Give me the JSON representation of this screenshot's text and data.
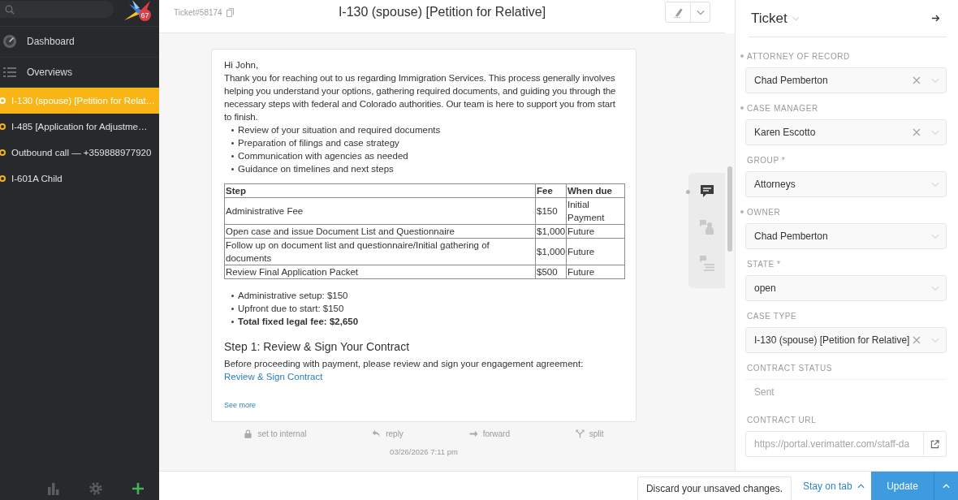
{
  "sidebar": {
    "notification_count": "67",
    "nav": [
      {
        "label": "Dashboard"
      },
      {
        "label": "Overviews"
      }
    ],
    "tabs": [
      {
        "label": "I-130 (spouse) [Petition for Relat…",
        "selected": true
      },
      {
        "label": "I-485 [Application for Adjustme…",
        "selected": false
      },
      {
        "label": "Outbound call — +359888977920",
        "selected": false
      },
      {
        "label": "I-601A Child",
        "selected": false
      }
    ]
  },
  "header": {
    "ticket_number": "Ticket#58174",
    "title": "I-130 (spouse) [Petition for Relative]"
  },
  "article": {
    "greeting": "Hi John,",
    "intro": "Thank you for reaching out to us regarding Immigration Services. This process generally involves helping you understand your options, gathering required documents, and guiding you through the necessary steps with federal and Colorado authorities. Our team is here to support you from start to finish.",
    "services": [
      "Review of your situation and required documents",
      "Preparation of filings and case strategy",
      "Communication with agencies as needed",
      "Guidance on timelines and next steps"
    ],
    "fee_table": {
      "columns": [
        "Step",
        "Fee",
        "When due"
      ],
      "rows": [
        [
          "Administrative Fee",
          "$150",
          "Initial Payment"
        ],
        [
          "Open case and issue Document List and Questionnaire",
          "$1,000",
          "Future"
        ],
        [
          "Follow up on document list and questionnaire/Initial gathering of documents",
          "$1,000",
          "Future"
        ],
        [
          "Review Final Application Packet",
          "$500",
          "Future"
        ]
      ]
    },
    "summary": [
      {
        "text": "Administrative setup: $150",
        "bold": false
      },
      {
        "text": "Upfront due to start: $150",
        "bold": false
      },
      {
        "text": "Total fixed legal fee: $2,650",
        "bold": true
      }
    ],
    "heading": "Step 1: Review & Sign Your Contract",
    "instruction": "Before proceeding with payment, please review and sign your engagement agreement:",
    "link": "Review & Sign Contract",
    "see_more": "See more",
    "actions": [
      {
        "label": "set to internal"
      },
      {
        "label": "reply"
      },
      {
        "label": "forward"
      },
      {
        "label": "split"
      }
    ],
    "timestamp": "03/26/2026 7:11 pm"
  },
  "sidebar_tabs": [
    {
      "selected": true
    },
    {
      "selected": false
    },
    {
      "selected": false
    }
  ],
  "ticket_panel": {
    "title": "Ticket",
    "fields": [
      {
        "label": "ATTORNEY OF RECORD",
        "value": "Chad Pemberton",
        "kind": "select",
        "changed": true,
        "clearable": true
      },
      {
        "label": "CASE MANAGER",
        "value": "Karen Escotto",
        "kind": "select",
        "changed": true,
        "clearable": true
      },
      {
        "label": "GROUP *",
        "value": "Attorneys",
        "kind": "select",
        "changed": false,
        "clearable": false
      },
      {
        "label": "OWNER",
        "value": "Chad Pemberton",
        "kind": "select",
        "changed": true,
        "clearable": false
      },
      {
        "label": "STATE *",
        "value": "open",
        "kind": "select",
        "changed": false,
        "clearable": false
      },
      {
        "label": "CASE TYPE",
        "value": "I-130 (spouse) [Petition for Relative]",
        "kind": "select",
        "changed": false,
        "clearable": true
      },
      {
        "label": "CONTRACT STATUS",
        "value": "Sent",
        "kind": "text",
        "changed": false
      },
      {
        "label": "CONTRACT URL",
        "value": "https://portal.verimatter.com/staff-da",
        "kind": "url",
        "changed": false
      }
    ]
  },
  "bottom_bar": {
    "discard": "Discard your unsaved changes.",
    "stay_on_tab": "Stay on tab",
    "update": "Update"
  }
}
